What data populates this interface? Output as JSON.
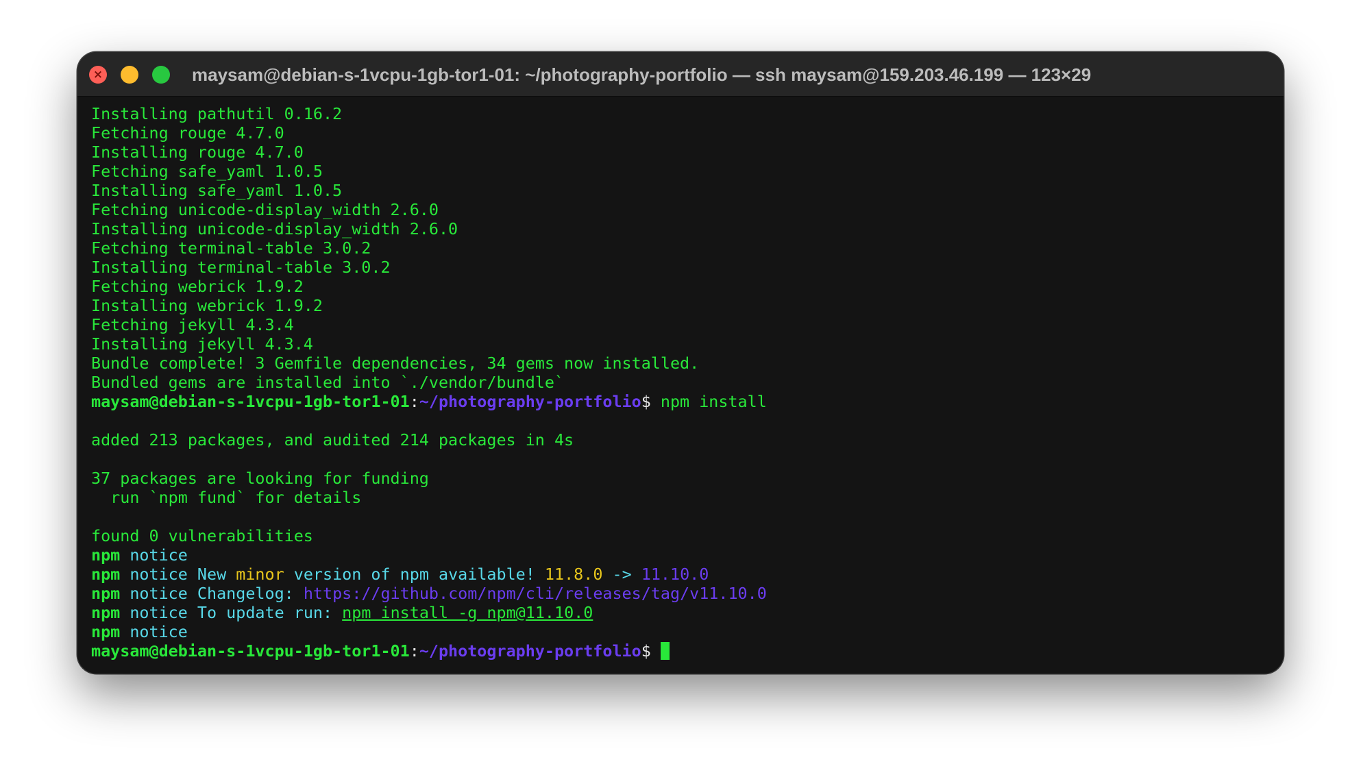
{
  "window": {
    "title": "maysam@debian-s-1vcpu-1gb-tor1-01: ~/photography-portfolio — ssh maysam@159.203.46.199 — 123×29",
    "controls": {
      "close_glyph": "×"
    }
  },
  "terminal": {
    "output_lines": [
      "Installing pathutil 0.16.2",
      "Fetching rouge 4.7.0",
      "Installing rouge 4.7.0",
      "Fetching safe_yaml 1.0.5",
      "Installing safe_yaml 1.0.5",
      "Fetching unicode-display_width 2.6.0",
      "Installing unicode-display_width 2.6.0",
      "Fetching terminal-table 3.0.2",
      "Installing terminal-table 3.0.2",
      "Fetching webrick 1.9.2",
      "Installing webrick 1.9.2",
      "Fetching jekyll 4.3.4",
      "Installing jekyll 4.3.4",
      "Bundle complete! 3 Gemfile dependencies, 34 gems now installed.",
      "Bundled gems are installed into `./vendor/bundle`"
    ],
    "prompt": {
      "user_host": "maysam@debian-s-1vcpu-1gb-tor1-01",
      "colon": ":",
      "path": "~/photography-portfolio",
      "dollar": "$ "
    },
    "command_1": "npm install",
    "npm_output": {
      "added": "added 213 packages, and audited 214 packages in 4s",
      "funding": "37 packages are looking for funding",
      "fund_hint": "  run `npm fund` for details",
      "vulnerabilities": "found 0 vulnerabilities"
    },
    "notices": {
      "npm_label": "npm",
      "notice_word": "notice",
      "new_version_pre": " New ",
      "minor": "minor",
      "new_version_mid": " version of npm available! ",
      "old_version": "11.8.0",
      "arrow": " -> ",
      "new_version": "11.10.0",
      "changelog_label": " Changelog: ",
      "changelog_url": "https://github.com/npm/cli/releases/tag/v11.10.0",
      "update_label": " To update run: ",
      "update_command": "npm install -g npm@11.10.0"
    }
  },
  "colors": {
    "green": "#29e83a",
    "purple": "#6b3df0",
    "cyan": "#58d8e8",
    "yellow": "#e8c61c",
    "background": "#141414"
  }
}
